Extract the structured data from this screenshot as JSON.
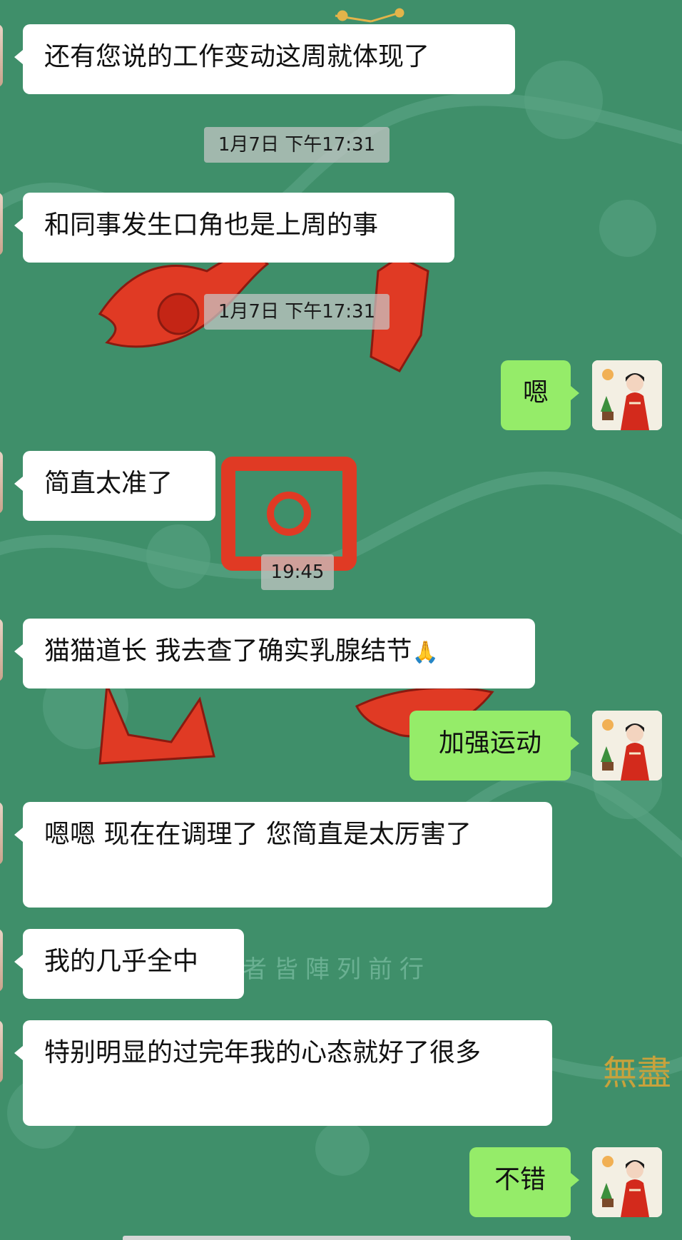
{
  "messages": [
    {
      "text": "还有您说的工作变动这周就体现了"
    },
    {
      "text": "和同事发生口角也是上周的事"
    },
    {
      "text": "嗯"
    },
    {
      "text": "简直太准了"
    },
    {
      "text": "猫猫道长  我去查了确实乳腺结节",
      "emoji": "🙏"
    },
    {
      "text": "加强运动"
    },
    {
      "text": "嗯嗯  现在在调理了  您简直是太厉害了"
    },
    {
      "text": "我的几乎全中"
    },
    {
      "text": "特别明显的过完年我的心态就好了很多"
    },
    {
      "text": "不错"
    }
  ],
  "timestamps": [
    "1月7日  下午17:31",
    "1月7日  下午17:31",
    "19:45"
  ],
  "background": {
    "caption": "者皆陣列前行",
    "seal": "無盡"
  },
  "colors": {
    "background": "#3f8f6a",
    "incoming_bubble": "#ffffff",
    "outgoing_bubble": "#95ec69",
    "timestamp_bg": "#c8c8c8"
  },
  "icons": [
    "avatar-left",
    "avatar-right-red-robe-figure",
    "prayer-hands-emoji"
  ]
}
